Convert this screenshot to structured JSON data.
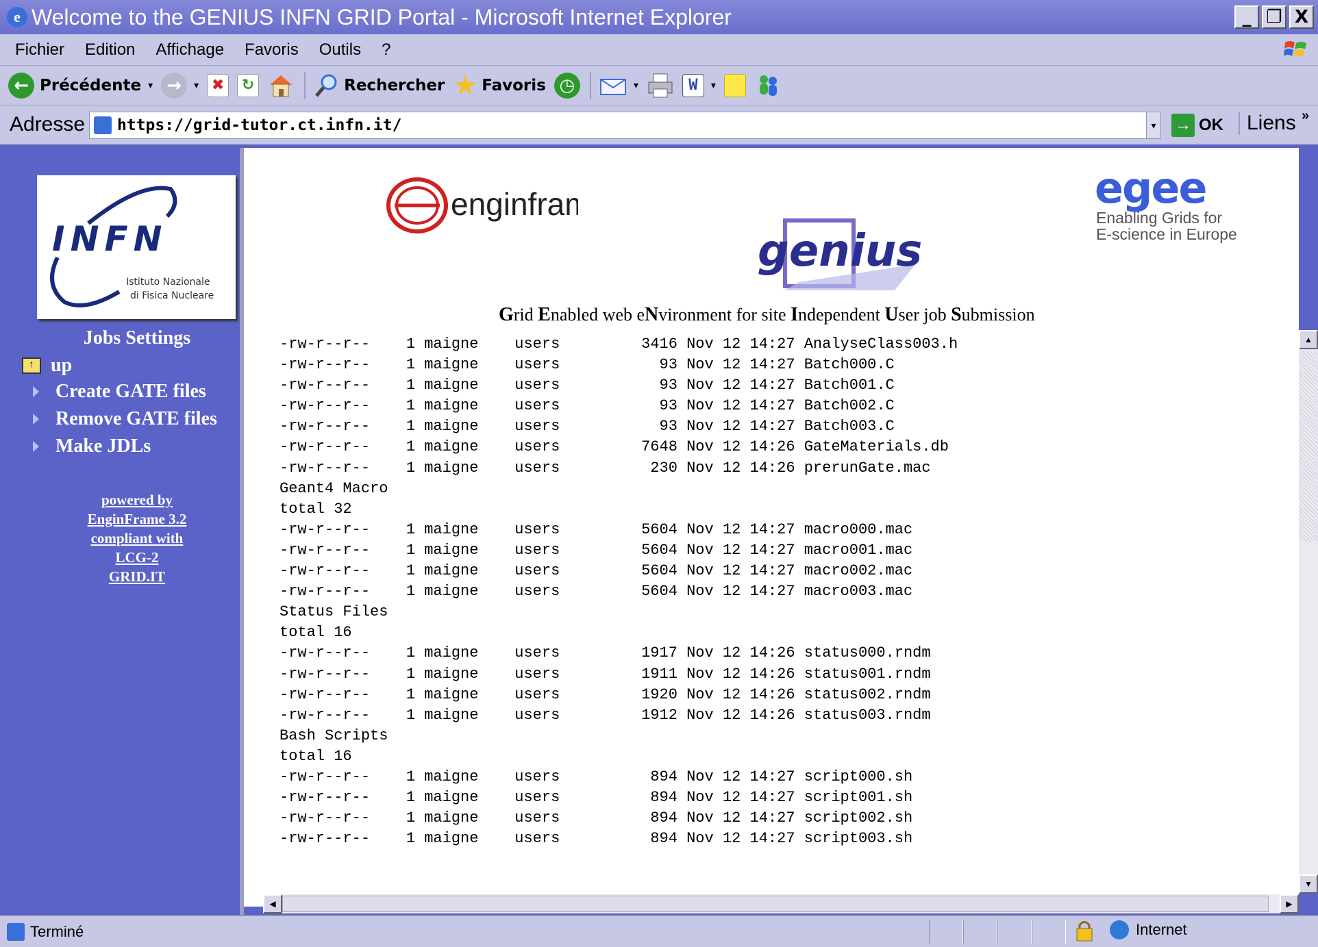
{
  "window": {
    "title": "Welcome to the GENIUS INFN GRID Portal - Microsoft Internet Explorer",
    "controls": [
      "_",
      "ᶜ",
      "X"
    ]
  },
  "menu": [
    "Fichier",
    "Edition",
    "Affichage",
    "Favoris",
    "Outils",
    "?"
  ],
  "toolbar": {
    "back_label": "Précédente",
    "search_label": "Rechercher",
    "favorites_label": "Favoris"
  },
  "address": {
    "label": "Adresse",
    "url": "https://grid-tutor.ct.infn.it/",
    "go_label": "OK",
    "links_label": "Liens"
  },
  "sidebar": {
    "logo_text": "INFN",
    "logo_subtitle_1": "Istituto Nazionale",
    "logo_subtitle_2": "di Fisica Nucleare",
    "section_title": "Jobs Settings",
    "up_label": "up",
    "items": [
      "Create GATE files",
      "Remove GATE files",
      "Make JDLs"
    ],
    "powered": [
      "powered by",
      "EnginFrame 3.2",
      "compliant with",
      "LCG-2",
      "GRID.IT"
    ]
  },
  "header": {
    "enginframe_logo": "enginframe",
    "genius_logo": "genius",
    "egee_logo": "egee",
    "egee_tagline_1": "Enabling Grids for",
    "egee_tagline_2": "E-science in Europe",
    "tagline_parts": [
      {
        "bold": "G",
        "rest": "rid "
      },
      {
        "bold": "E",
        "rest": "nabled web e"
      },
      {
        "bold": "N",
        "rest": "vironment for site "
      },
      {
        "bold": "I",
        "rest": "ndependent "
      },
      {
        "bold": "U",
        "rest": "ser job "
      },
      {
        "bold": "S",
        "rest": "ubmission"
      }
    ]
  },
  "listing": [
    "-rw-r--r--    1 maigne    users         3416 Nov 12 14:27 AnalyseClass003.h",
    "-rw-r--r--    1 maigne    users           93 Nov 12 14:27 Batch000.C",
    "-rw-r--r--    1 maigne    users           93 Nov 12 14:27 Batch001.C",
    "-rw-r--r--    1 maigne    users           93 Nov 12 14:27 Batch002.C",
    "-rw-r--r--    1 maigne    users           93 Nov 12 14:27 Batch003.C",
    "-rw-r--r--    1 maigne    users         7648 Nov 12 14:26 GateMaterials.db",
    "-rw-r--r--    1 maigne    users          230 Nov 12 14:26 prerunGate.mac",
    "Geant4 Macro",
    "total 32",
    "-rw-r--r--    1 maigne    users         5604 Nov 12 14:27 macro000.mac",
    "-rw-r--r--    1 maigne    users         5604 Nov 12 14:27 macro001.mac",
    "-rw-r--r--    1 maigne    users         5604 Nov 12 14:27 macro002.mac",
    "-rw-r--r--    1 maigne    users         5604 Nov 12 14:27 macro003.mac",
    "Status Files",
    "total 16",
    "-rw-r--r--    1 maigne    users         1917 Nov 12 14:26 status000.rndm",
    "-rw-r--r--    1 maigne    users         1911 Nov 12 14:26 status001.rndm",
    "-rw-r--r--    1 maigne    users         1920 Nov 12 14:26 status002.rndm",
    "-rw-r--r--    1 maigne    users         1912 Nov 12 14:26 status003.rndm",
    "Bash Scripts",
    "total 16",
    "-rw-r--r--    1 maigne    users          894 Nov 12 14:27 script000.sh",
    "-rw-r--r--    1 maigne    users          894 Nov 12 14:27 script001.sh",
    "-rw-r--r--    1 maigne    users          894 Nov 12 14:27 script002.sh",
    "-rw-r--r--    1 maigne    users          894 Nov 12 14:27 script003.sh"
  ],
  "status": {
    "text": "Terminé",
    "zone": "Internet"
  },
  "colors": {
    "sidebar_bg": "#5b62c8",
    "chrome_bg": "#c6c8e6",
    "genius_blue": "#2a2f8f",
    "egee_blue": "#3b5ed8",
    "enginframe_red": "#d02020"
  }
}
